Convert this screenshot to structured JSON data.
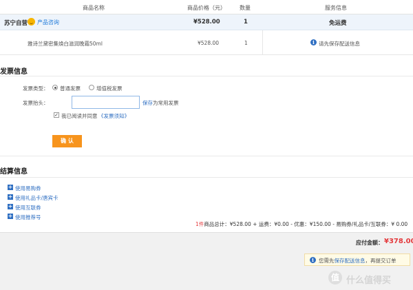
{
  "table_header": {
    "product_name": "商品名称",
    "price": "商品价格（元）",
    "quantity": "数量",
    "service": "服务信息"
  },
  "store_row": {
    "store_name": "苏宁自营",
    "consult_link": "产品咨询",
    "price": "¥528.00",
    "quantity": "1",
    "shipping": "免运费"
  },
  "product_row": {
    "name": "雅诗兰黛密集焕白滋润晚霜50ml",
    "price": "¥528.00",
    "quantity": "1",
    "service_hint": "请先保存配送信息"
  },
  "invoice": {
    "title": "发票信息",
    "type_label": "发票类型：",
    "type_options": [
      "普通发票",
      "增值税发票"
    ],
    "type_selected": "普通发票",
    "header_label": "发票抬头：",
    "header_value": "",
    "save_link": "保存",
    "save_suffix": "为常用发票",
    "agree_checked": true,
    "agree_text": "我已阅读并同意",
    "agree_link": "《发票须知》",
    "confirm_label": "确 认"
  },
  "settlement": {
    "title": "结算信息",
    "options": [
      "使用易购券",
      "使用礼品卡/唐宾卡",
      "使用互联券",
      "使用推荐号"
    ],
    "summary_count": "1件",
    "summary_text": "商品总计：¥528.00 + 运费：¥0.00 - 优惠：¥150.00 - 易购券/礼品卡/互联券：¥ 0.00"
  },
  "payment": {
    "label": "应付金额：",
    "amount": "¥378.00",
    "notice_prefix": "您需先",
    "notice_link": "保存配送信息",
    "notice_suffix": "，再提交订单"
  },
  "watermark": {
    "icon": "值",
    "text": "什么值得买"
  },
  "colors": {
    "accent": "#f7941d",
    "price_red": "#e4393c",
    "link_blue": "#2f6fc2"
  }
}
